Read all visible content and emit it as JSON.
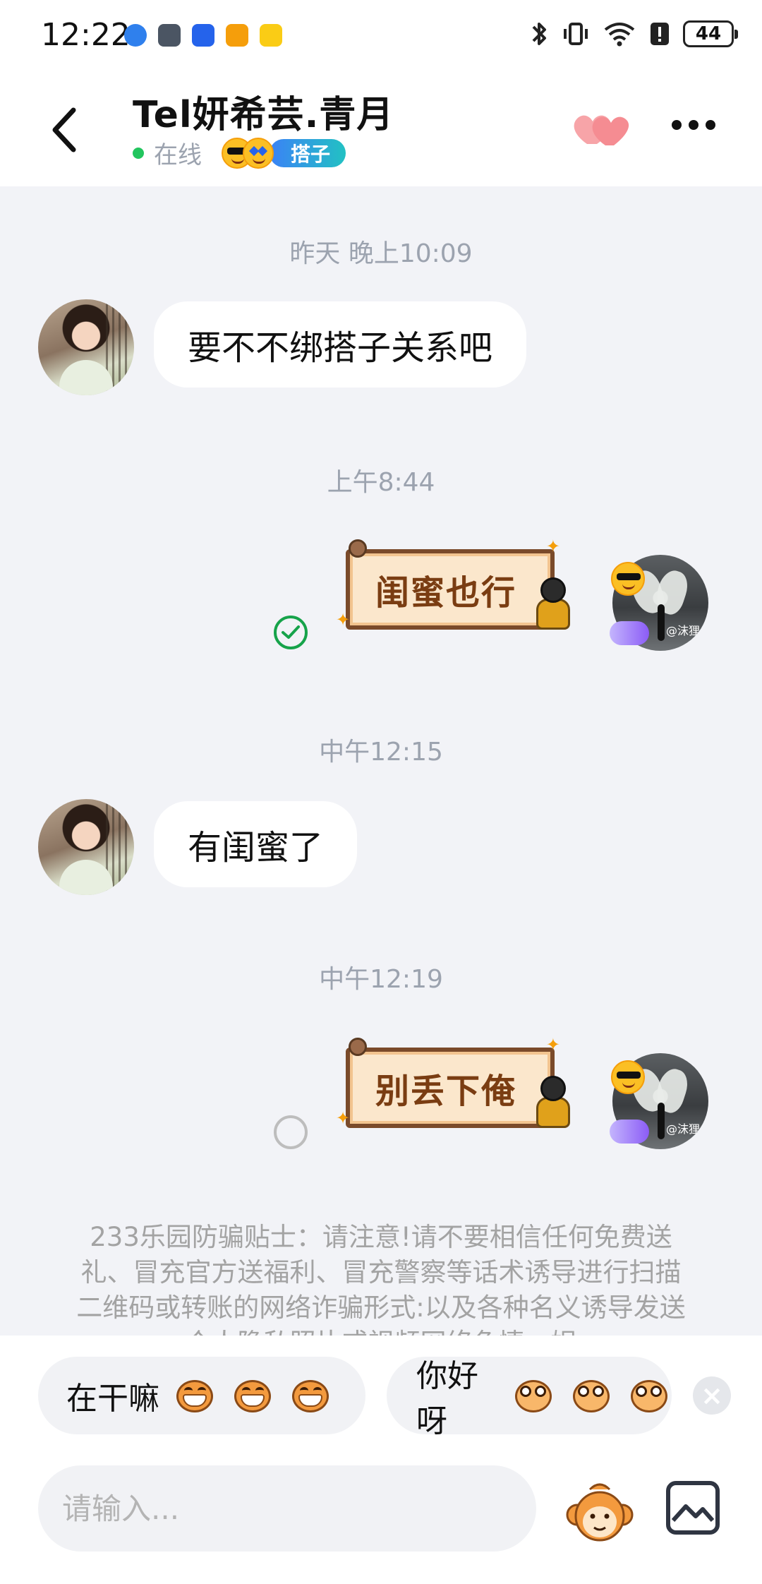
{
  "status_bar": {
    "time": "12:22",
    "battery": "44"
  },
  "header": {
    "contact_name": "Tel妍希芸.青月",
    "online_status": "在线",
    "badge": "搭子"
  },
  "messages": [
    {
      "time": "昨天 晚上10:09",
      "from": "them",
      "type": "text",
      "text": "要不不绑搭子关系吧"
    },
    {
      "time": "上午8:44",
      "from": "me",
      "type": "sticker",
      "text": "闺蜜也行",
      "read": true
    },
    {
      "time": "中午12:15",
      "from": "them",
      "type": "text",
      "text": "有闺蜜了"
    },
    {
      "time": "中午12:19",
      "from": "me",
      "type": "sticker",
      "text": "别丢下俺",
      "read": false
    }
  ],
  "my_avatar_watermark": "@沫狸",
  "safety_tip": "233乐园防骗贴士：请注意!请不要相信任何免费送礼、冒充官方送福利、冒充警察等话术诱导进行扫描二维码或转账的网络诈骗形式:以及各种名义诱导发送个人隐私照片或视频网络色情、娱",
  "quick_replies": [
    {
      "text": "在干嘛",
      "emoji": "grinning-monkey"
    },
    {
      "text": "你好呀",
      "emoji": "wide-eyed-monkey"
    }
  ],
  "input": {
    "placeholder": "请输入..."
  },
  "colors": {
    "online": "#22c55e",
    "badge_start": "#3b82f6",
    "badge_end": "#22c1c3",
    "read": "#16a34a",
    "background": "#f2f3f7"
  }
}
